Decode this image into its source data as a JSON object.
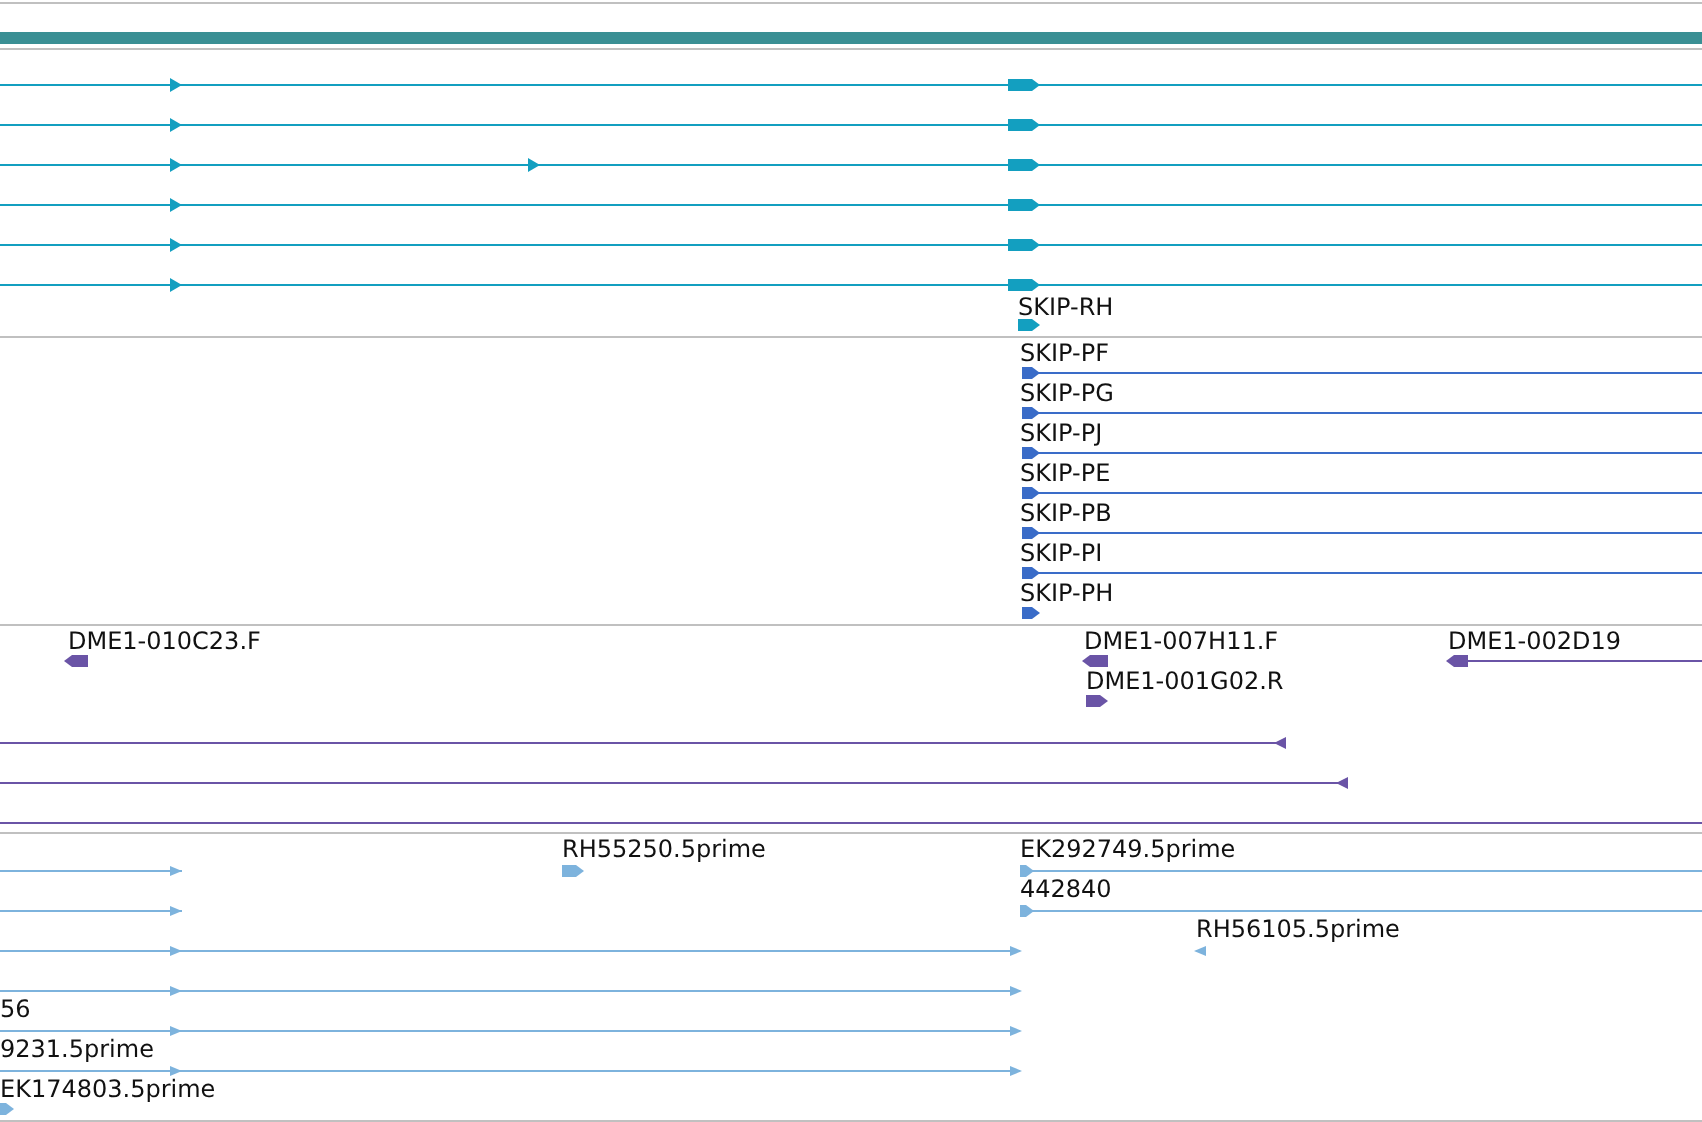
{
  "tracks": [
    {
      "kind": "transcript",
      "color": "#139fc0",
      "features": [
        {
          "reverse_strand": false
        },
        {
          "reverse_strand": false
        },
        {
          "reverse_strand": false
        },
        {
          "reverse_strand": false
        },
        {
          "reverse_strand": false
        },
        {
          "reverse_strand": false
        },
        {
          "label": "SKIP-RH",
          "reverse_strand": false
        }
      ]
    },
    {
      "kind": "transcript",
      "color": "#3a6cc8",
      "features": [
        {
          "label": "SKIP-PF",
          "reverse_strand": false
        },
        {
          "label": "SKIP-PG",
          "reverse_strand": false
        },
        {
          "label": "SKIP-PJ",
          "reverse_strand": false
        },
        {
          "label": "SKIP-PE",
          "reverse_strand": false
        },
        {
          "label": "SKIP-PB",
          "reverse_strand": false
        },
        {
          "label": "SKIP-PI",
          "reverse_strand": false
        },
        {
          "label": "SKIP-PH",
          "reverse_strand": false
        }
      ]
    },
    {
      "kind": "clone",
      "color": "#6a54a6",
      "features": [
        {
          "label": "DME1-010C23.F",
          "reverse_strand": true
        },
        {
          "label": "DME1-007H11.F",
          "reverse_strand": true
        },
        {
          "label": "DME1-002D19",
          "reverse_strand": true
        },
        {
          "label": "DME1-001G02.R",
          "reverse_strand": false
        },
        {
          "reverse_strand": true
        },
        {
          "reverse_strand": true
        }
      ]
    },
    {
      "kind": "est",
      "color": "#7db3dd",
      "features": [
        {
          "reverse_strand": false
        },
        {
          "label": "RH55250.5prime",
          "reverse_strand": false
        },
        {
          "label": "EK292749.5prime",
          "reverse_strand": false
        },
        {
          "reverse_strand": false
        },
        {
          "label": "442840",
          "reverse_strand": false
        },
        {
          "reverse_strand": false
        },
        {
          "label": "RH56105.5prime",
          "reverse_strand": true
        },
        {
          "reverse_strand": false
        },
        {
          "label": "56",
          "reverse_strand": false
        },
        {
          "label": "9231.5prime",
          "reverse_strand": false
        },
        {
          "label": "EK174803.5prime",
          "reverse_strand": false
        }
      ]
    }
  ]
}
